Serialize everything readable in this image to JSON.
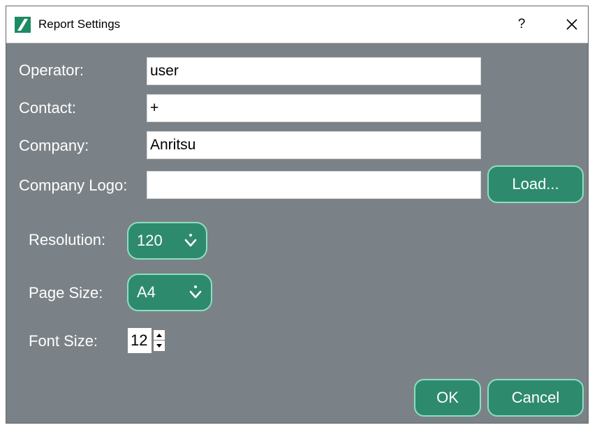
{
  "window": {
    "title": "Report Settings",
    "help_label": "?",
    "logo_icon": "anritsu-logo-icon",
    "close_icon": "close-icon"
  },
  "fields": {
    "operator": {
      "label": "Operator:",
      "value": "user"
    },
    "contact": {
      "label": "Contact:",
      "value": "+"
    },
    "company": {
      "label": "Company:",
      "value": "Anritsu"
    },
    "company_logo": {
      "label": "Company Logo:",
      "value": ""
    }
  },
  "load_button": {
    "label": "Load..."
  },
  "resolution": {
    "label": "Resolution:",
    "value": "120",
    "icon": "chevron-down-icon"
  },
  "page_size": {
    "label": "Page Size:",
    "value": "A4",
    "icon": "chevron-down-icon"
  },
  "font_size": {
    "label": "Font Size:",
    "value": "12"
  },
  "buttons": {
    "ok": "OK",
    "cancel": "Cancel"
  },
  "colors": {
    "dialog_bg": "#7b8287",
    "accent": "#2e8a6c",
    "accent_border": "#8ce0bf",
    "logo_green": "#1e8a64"
  }
}
